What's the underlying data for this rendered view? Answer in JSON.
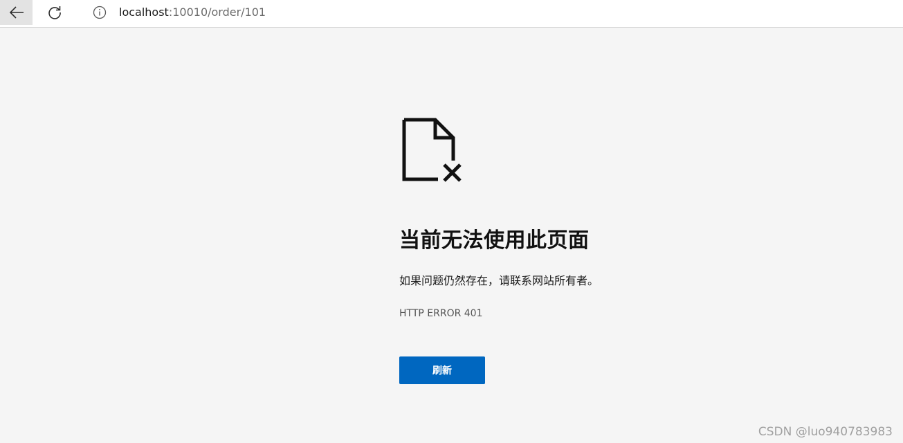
{
  "browser": {
    "url_host": "localhost",
    "url_rest": ":10010/order/101"
  },
  "error_page": {
    "title": "当前无法使用此页面",
    "message": "如果问题仍然存在，请联系网站所有者。",
    "error_code": "HTTP ERROR 401",
    "refresh_label": "刷新"
  },
  "watermark": "CSDN @luo940783983",
  "icons": {
    "back": "back-arrow-icon",
    "reload": "reload-icon",
    "info": "info-icon",
    "error_document": "broken-document-icon"
  },
  "colors": {
    "primary_button": "#0067c0",
    "page_background": "#f5f5f5"
  }
}
